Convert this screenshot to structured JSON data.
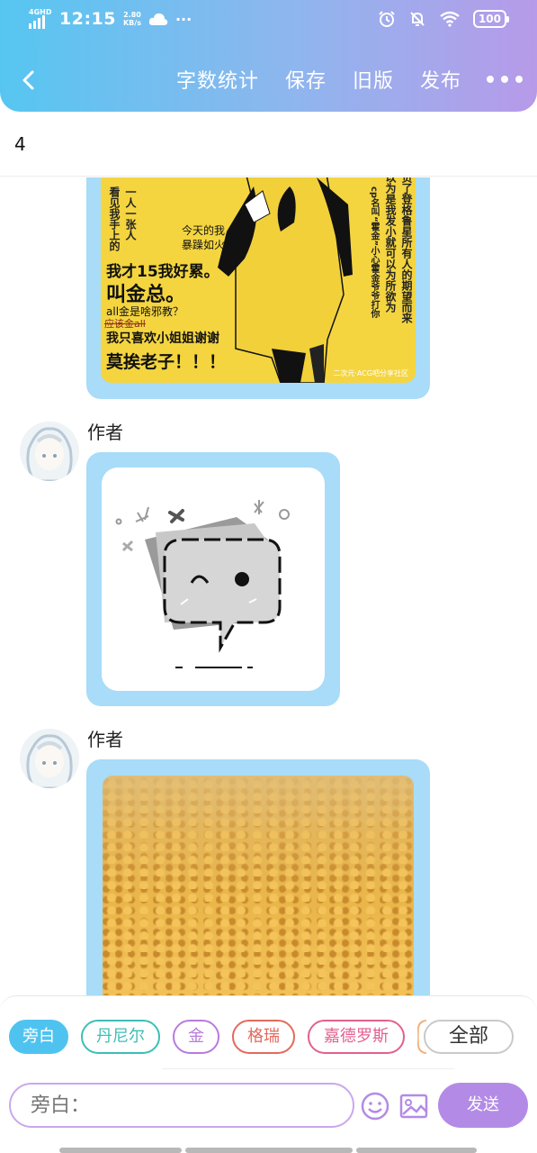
{
  "status_bar": {
    "network": "4GHD",
    "time": "12:15",
    "speed_value": "2.80",
    "speed_unit": "KB/s",
    "overflow": "···",
    "battery": "100"
  },
  "nav": {
    "word_count_label": "字数统计",
    "save_label": "保存",
    "old_version_label": "旧版",
    "publish_label": "发布"
  },
  "title": "4",
  "messages": [
    {
      "author": "",
      "image_text": {
        "col1": "看见我手上的",
        "col2": "一人一张人",
        "line_today": "今天的我",
        "line_today2": "暴躁如火",
        "line1": "我才15我好累。",
        "line2": "叫金总。",
        "line3": "all金是啥邪教？",
        "line_strike": "应该金all",
        "line4": "我只喜欢小姐姐谢谢",
        "line5": "莫挨老子！！！",
        "right_col1": "负了登格鲁星所有人的期望而来",
        "right_col2": "以为是我发小就可以为所欲为",
        "right_col3": "cp名叫“霍金”小心霍金爷爷打你",
        "watermark": "二次元·ACG吧分享社区"
      }
    },
    {
      "author": "作者"
    },
    {
      "author": "作者"
    }
  ],
  "roles": [
    {
      "label": "旁白",
      "color": "#4fc3f0",
      "active": true
    },
    {
      "label": "丹尼尔",
      "color": "#3cbfb5",
      "active": false
    },
    {
      "label": "金",
      "color": "#b77bdc",
      "active": false
    },
    {
      "label": "格瑞",
      "color": "#e26a5c",
      "active": false
    },
    {
      "label": "嘉德罗斯",
      "color": "#e3608f",
      "active": false
    }
  ],
  "all_roles_label": "全部",
  "composer": {
    "placeholder": "旁白：",
    "send_label": "发送"
  },
  "colors": {
    "header_start": "#56c6f1",
    "header_end": "#b79ae9",
    "bubble": "#a8dcf8",
    "send": "#b38be6"
  }
}
